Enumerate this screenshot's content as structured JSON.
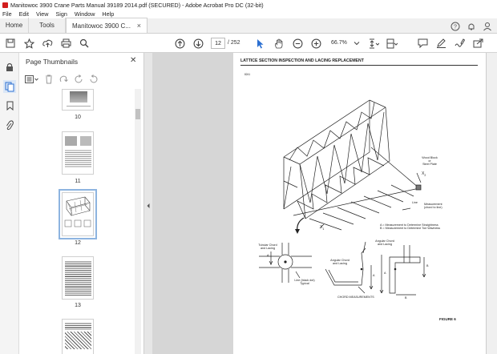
{
  "window": {
    "title": "Manitowoc 3900 Crane Parts Manual 39189 2014.pdf (SECURED) - Adobe Acrobat Pro DC (32-bit)"
  },
  "menu": [
    "File",
    "Edit",
    "View",
    "Sign",
    "Window",
    "Help"
  ],
  "tabs": {
    "home": "Home",
    "tools": "Tools",
    "document": "Manitowoc 3900 C..."
  },
  "toolbar": {
    "current_page": "12",
    "page_total": "/ 252",
    "zoom": "66.7%"
  },
  "panel": {
    "title": "Page Thumbnails",
    "thumbnails": [
      {
        "label": "10"
      },
      {
        "label": "11"
      },
      {
        "label": "12",
        "selected": true
      },
      {
        "label": "13"
      },
      {
        "label": ""
      }
    ]
  },
  "document": {
    "heading": "LATTICE SECTION INSPECTION AND LACING REPLACEMENT",
    "code": "8241",
    "labels": {
      "wood_block": "Wood Block",
      "or": "or",
      "steel_plate": "Steel Plate",
      "x2": "X",
      "x2_sub": "2",
      "line": "Line",
      "measurement": "Measurement",
      "chord_to_line": "(chord to line)",
      "x1": "X",
      "x1_sub": "1",
      "legend_a": "A = Measurement to Determine Straightness",
      "legend_b": "B = Measurement to Determine Toe Waviness",
      "tubular_1": "Tubular Chord",
      "tubular_2": "and Lacing",
      "angular_1": "Angular Chord",
      "angular_2": "and Lacing",
      "angular2_1": "Angular Chord",
      "angular2_2": "and Lacing",
      "black_dot_1": "Line (black dot)",
      "black_dot_2": "Typical",
      "a1": "A",
      "a2": "A",
      "a3": "A",
      "b1": "B",
      "b2": "B",
      "chord_measurements": "CHORD MEASUREMENTS",
      "figure": "FIGURE 6"
    }
  }
}
